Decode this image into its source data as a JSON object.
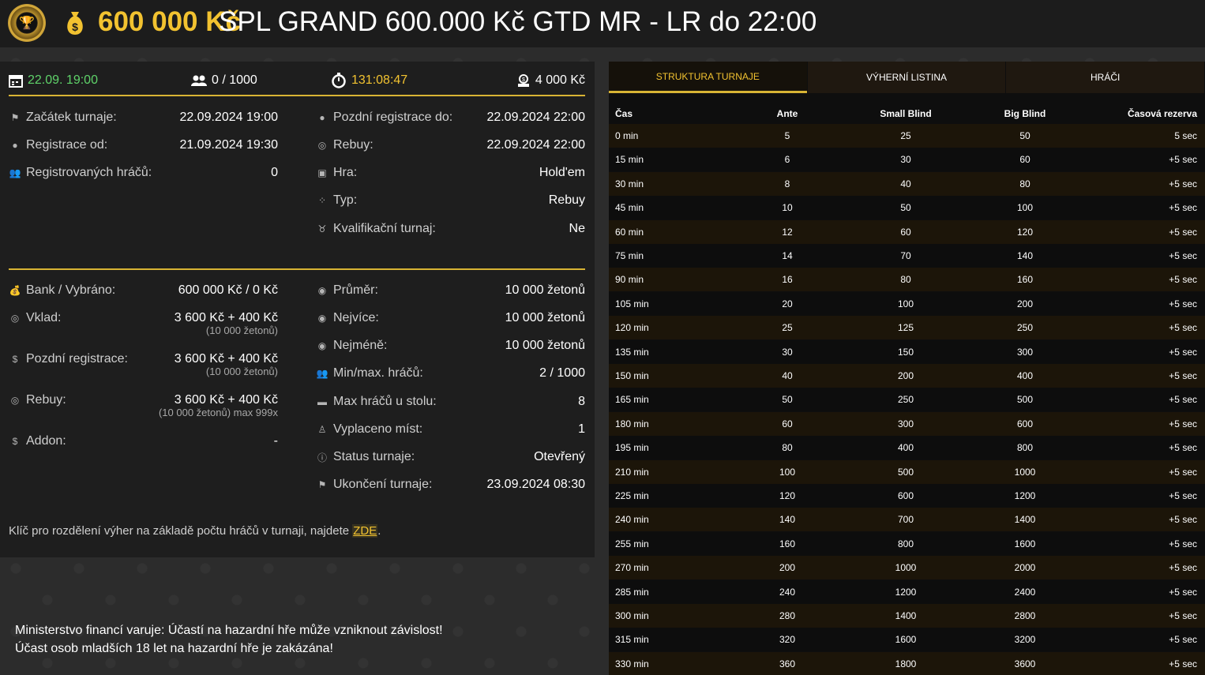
{
  "header": {
    "amount": "600 000 Kč",
    "title": "SPL GRAND 600.000 Kč GTD MR - LR do 22:00"
  },
  "stats": {
    "date": "22.09. 19:00",
    "players": "0 / 1000",
    "timer": "131:08:47",
    "buyin": "4 000 Kč"
  },
  "info_left": [
    {
      "icon": "flag-icon",
      "label": "Začátek turnaje:",
      "value": "22.09.2024 19:00"
    },
    {
      "icon": "user-icon",
      "label": "Registrace od:",
      "value": "21.09.2024 19:30"
    },
    {
      "icon": "users-icon",
      "label": "Registrovaných hráčů:",
      "value": "0"
    }
  ],
  "info_right": [
    {
      "icon": "user-icon",
      "label": "Pozdní registrace do:",
      "value": "22.09.2024 22:00"
    },
    {
      "icon": "coins-icon",
      "label": "Rebuy:",
      "value": "22.09.2024 22:00"
    },
    {
      "icon": "cards-icon",
      "label": "Hra:",
      "value": "Hold'em"
    },
    {
      "icon": "dice-icon",
      "label": "Typ:",
      "value": "Rebuy"
    },
    {
      "icon": "medal-icon",
      "label": "Kvalifikační turnaj:",
      "value": "Ne"
    }
  ],
  "money_left": [
    {
      "icon": "moneybag-icon",
      "label": "Bank / Vybráno:",
      "value": "600 000 Kč / 0 Kč",
      "sub": ""
    },
    {
      "icon": "coins-icon",
      "label": "Vklad:",
      "value": "3 600 Kč + 400 Kč",
      "sub": "(10 000 žetonů)"
    },
    {
      "icon": "dollar-icon",
      "label": "Pozdní registrace:",
      "value": "3 600 Kč + 400 Kč",
      "sub": "(10 000 žetonů)"
    },
    {
      "icon": "coins-icon",
      "label": "Rebuy:",
      "value": "3 600 Kč + 400 Kč",
      "sub": "(10 000 žetonů) max 999x"
    },
    {
      "icon": "dollar-icon",
      "label": "Addon:",
      "value": "-",
      "sub": ""
    }
  ],
  "money_right": [
    {
      "icon": "chip-icon",
      "label": "Průměr:",
      "value": "10 000 žetonů"
    },
    {
      "icon": "chip-icon",
      "label": "Nejvíce:",
      "value": "10 000 žetonů"
    },
    {
      "icon": "chip-icon",
      "label": "Nejméně:",
      "value": "10 000 žetonů"
    },
    {
      "icon": "users-icon",
      "label": "Min/max. hráčů:",
      "value": "2 / 1000"
    },
    {
      "icon": "table-icon",
      "label": "Max hráčů u stolu:",
      "value": "8"
    },
    {
      "icon": "podium-icon",
      "label": "Vyplaceno míst:",
      "value": "1"
    },
    {
      "icon": "info-icon",
      "label": "Status turnaje:",
      "value": "Otevřený"
    },
    {
      "icon": "flag-icon",
      "label": "Ukončení turnaje:",
      "value": "23.09.2024 08:30"
    }
  ],
  "note": {
    "text": "Klíč pro rozdělení výher na základě počtu hráčů v turnaji, najdete ",
    "link": "ZDE",
    "end": "."
  },
  "warning": {
    "line1": "Ministerstvo financí varuje: Účastí na hazardní hře může vzniknout závislost!",
    "line2": "Účast osob mladších 18 let na hazardní hře je zakázána!"
  },
  "tabs": [
    "STRUKTURA TURNAJE",
    "VÝHERNÍ LISTINA",
    "HRÁČI"
  ],
  "table": {
    "headers": [
      "Čas",
      "Ante",
      "Small Blind",
      "Big Blind",
      "Časová rezerva"
    ],
    "rows": [
      [
        "0 min",
        "5",
        "25",
        "50",
        "5 sec"
      ],
      [
        "15 min",
        "6",
        "30",
        "60",
        "+5 sec"
      ],
      [
        "30 min",
        "8",
        "40",
        "80",
        "+5 sec"
      ],
      [
        "45 min",
        "10",
        "50",
        "100",
        "+5 sec"
      ],
      [
        "60 min",
        "12",
        "60",
        "120",
        "+5 sec"
      ],
      [
        "75 min",
        "14",
        "70",
        "140",
        "+5 sec"
      ],
      [
        "90 min",
        "16",
        "80",
        "160",
        "+5 sec"
      ],
      [
        "105 min",
        "20",
        "100",
        "200",
        "+5 sec"
      ],
      [
        "120 min",
        "25",
        "125",
        "250",
        "+5 sec"
      ],
      [
        "135 min",
        "30",
        "150",
        "300",
        "+5 sec"
      ],
      [
        "150 min",
        "40",
        "200",
        "400",
        "+5 sec"
      ],
      [
        "165 min",
        "50",
        "250",
        "500",
        "+5 sec"
      ],
      [
        "180 min",
        "60",
        "300",
        "600",
        "+5 sec"
      ],
      [
        "195 min",
        "80",
        "400",
        "800",
        "+5 sec"
      ],
      [
        "210 min",
        "100",
        "500",
        "1000",
        "+5 sec"
      ],
      [
        "225 min",
        "120",
        "600",
        "1200",
        "+5 sec"
      ],
      [
        "240 min",
        "140",
        "700",
        "1400",
        "+5 sec"
      ],
      [
        "255 min",
        "160",
        "800",
        "1600",
        "+5 sec"
      ],
      [
        "270 min",
        "200",
        "1000",
        "2000",
        "+5 sec"
      ],
      [
        "285 min",
        "240",
        "1200",
        "2400",
        "+5 sec"
      ],
      [
        "300 min",
        "280",
        "1400",
        "2800",
        "+5 sec"
      ],
      [
        "315 min",
        "320",
        "1600",
        "3200",
        "+5 sec"
      ],
      [
        "330 min",
        "360",
        "1800",
        "3600",
        "+5 sec"
      ]
    ]
  }
}
